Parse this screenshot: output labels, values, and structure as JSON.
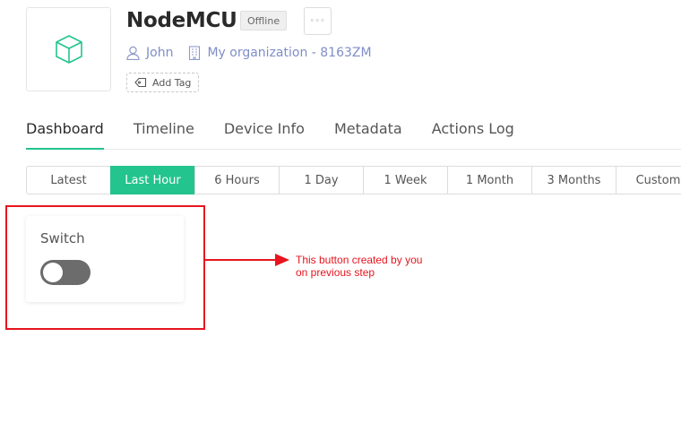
{
  "device": {
    "name": "NodeMCU",
    "status": "Offline",
    "more_label": "◦◦◦",
    "owner": "John",
    "organization": "My organization - 8163ZM",
    "add_tag_label": "Add Tag",
    "icon": "cube-icon"
  },
  "tabs": [
    {
      "label": "Dashboard",
      "active": true
    },
    {
      "label": "Timeline",
      "active": false
    },
    {
      "label": "Device Info",
      "active": false
    },
    {
      "label": "Metadata",
      "active": false
    },
    {
      "label": "Actions Log",
      "active": false
    }
  ],
  "time_range": [
    {
      "label": "Latest",
      "active": false
    },
    {
      "label": "Last Hour",
      "active": true
    },
    {
      "label": "6 Hours",
      "active": false
    },
    {
      "label": "1 Day",
      "active": false
    },
    {
      "label": "1 Week",
      "active": false
    },
    {
      "label": "1 Month",
      "active": false
    },
    {
      "label": "3 Months",
      "active": false
    },
    {
      "label": "Custom",
      "active": false
    }
  ],
  "widget": {
    "title": "Switch",
    "state": "off"
  },
  "annotation": {
    "line1": "This button created by you",
    "line2": "on previous step"
  },
  "colors": {
    "accent": "#23c48e",
    "annotation": "#e8141e",
    "link": "#7f8ec7"
  }
}
